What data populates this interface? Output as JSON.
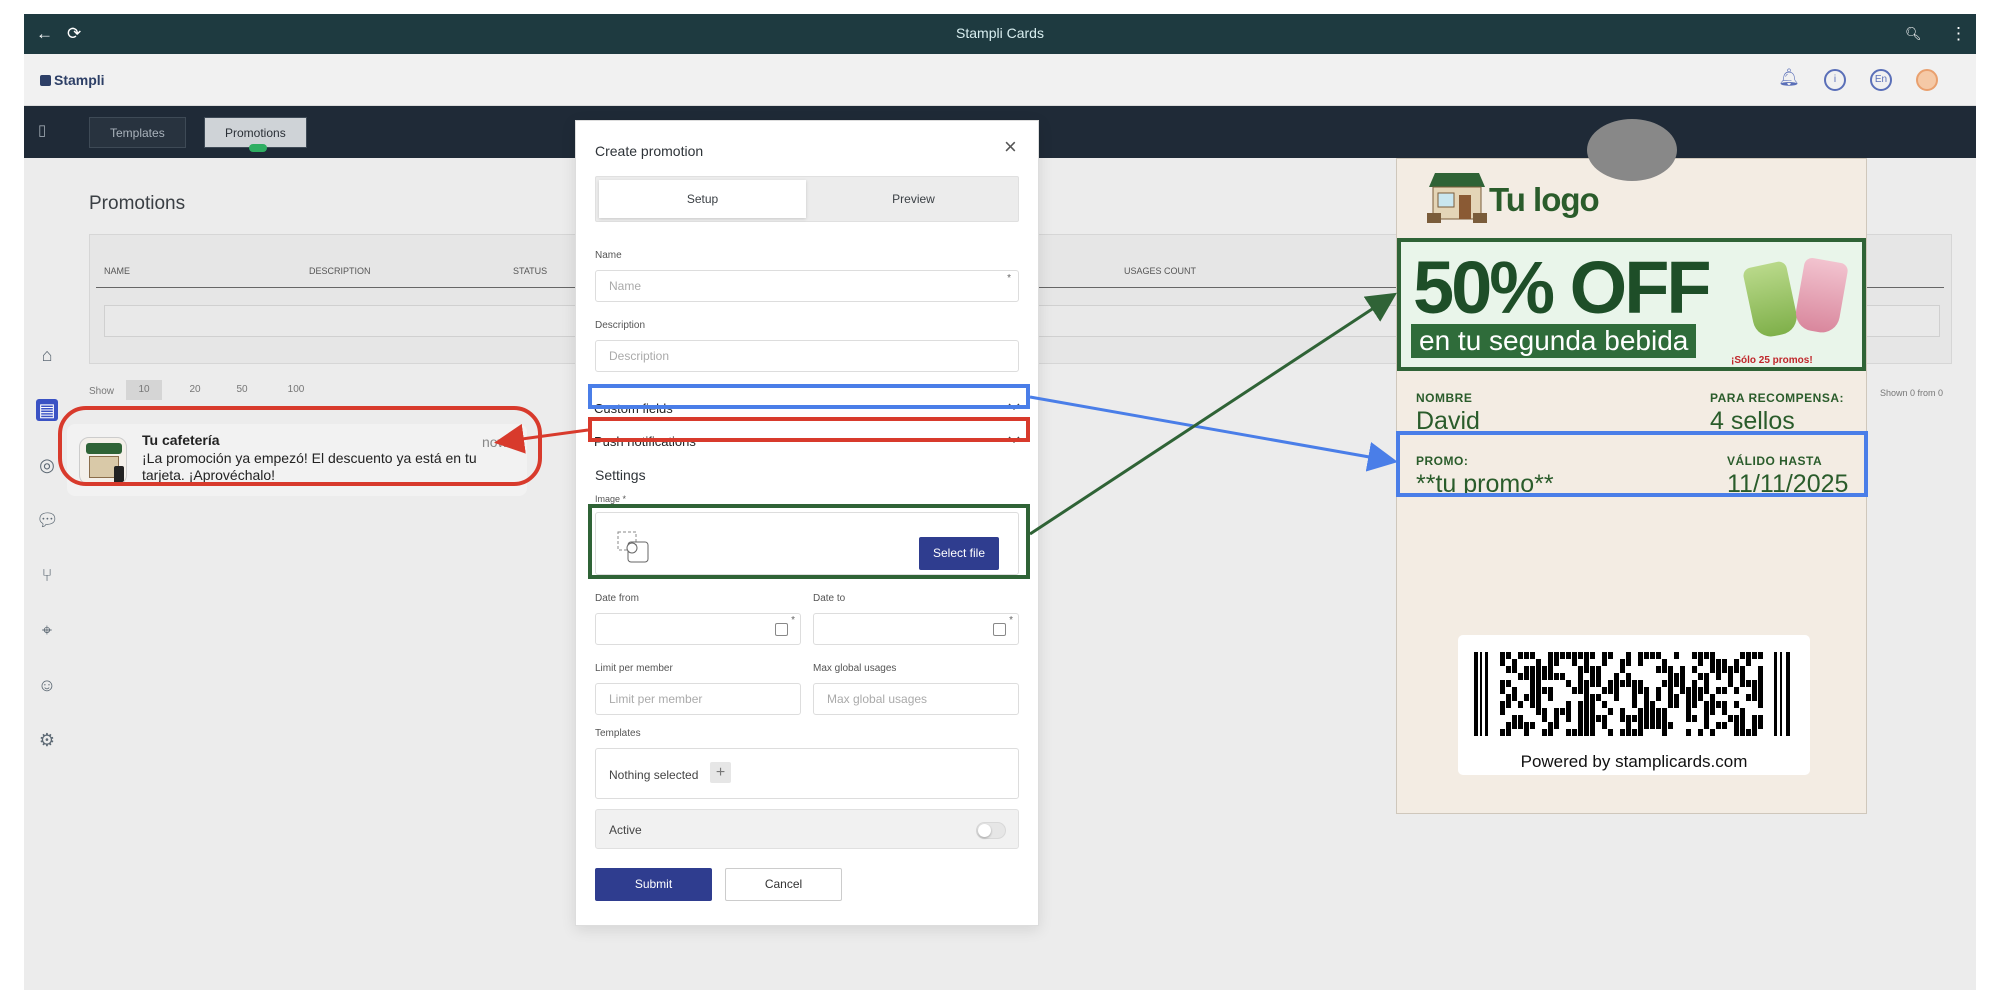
{
  "window": {
    "title": "Stampli Cards"
  },
  "header": {
    "logo": "Stampli",
    "lang": "En",
    "info": "i"
  },
  "nav": {
    "templates": "Templates",
    "promotions": "Promotions"
  },
  "page": {
    "title": "Promotions",
    "columns": [
      "NAME",
      "DESCRIPTION",
      "STATUS",
      "USAGES COUNT"
    ],
    "show_label": "Show",
    "page_sizes": [
      "10",
      "20",
      "50",
      "100"
    ],
    "shown": "Shown 0 from 0"
  },
  "modal": {
    "title": "Create promotion",
    "close": "×",
    "tabs": {
      "setup": "Setup",
      "preview": "Preview"
    },
    "name_label": "Name",
    "name_placeholder": "Name",
    "description_label": "Description",
    "description_placeholder": "Description",
    "custom_fields": "Custom fields",
    "push_notifications": "Push notifications",
    "settings": "Settings",
    "image_label": "Image *",
    "select_file": "Select file",
    "date_from": "Date from",
    "date_to": "Date to",
    "limit_label": "Limit per member",
    "limit_placeholder": "Limit per member",
    "max_label": "Max global usages",
    "max_placeholder": "Max global usages",
    "templates_label": "Templates",
    "nothing_selected": "Nothing selected",
    "plus": "+",
    "active_label": "Active",
    "active": false,
    "submit": "Submit",
    "cancel": "Cancel",
    "required": "*"
  },
  "notification": {
    "title": "Tu cafetería",
    "time": "now",
    "body": "¡La promoción ya empezó! El descuento ya está en tu tarjeta. ¡Aprovéchalo!"
  },
  "card": {
    "logo_text": "Tu logo",
    "banner_big": "50% OFF",
    "banner_sub": "en tu segunda bebida",
    "banner_tag": "¡Sólo 25 promos!",
    "name_label": "NOMBRE",
    "name_value": "David",
    "reward_label": "PARA RECOMPENSA:",
    "reward_value": "4 sellos",
    "promo_label": "PROMO:",
    "promo_value": "**tu promo**",
    "valid_label": "VÁLIDO HASTA",
    "valid_value": "11/11/2025",
    "powered": "Powered by stamplicards.com"
  },
  "colors": {
    "blue": "#4a7ee8",
    "red": "#d83a2c",
    "green": "#2f6336",
    "primary": "#2f3d8f"
  },
  "icons": [
    "back-arrow-icon",
    "refresh-icon",
    "zoom-icon",
    "kebab-menu-icon",
    "bell-icon",
    "info-icon",
    "language-icon",
    "avatar-icon",
    "phone-icon",
    "home-icon",
    "card-icon",
    "chat-icon",
    "flow-icon",
    "location-icon",
    "user-icon",
    "gear-icon",
    "image-placeholder-icon",
    "calendar-icon",
    "chevron-down-icon",
    "close-icon"
  ]
}
